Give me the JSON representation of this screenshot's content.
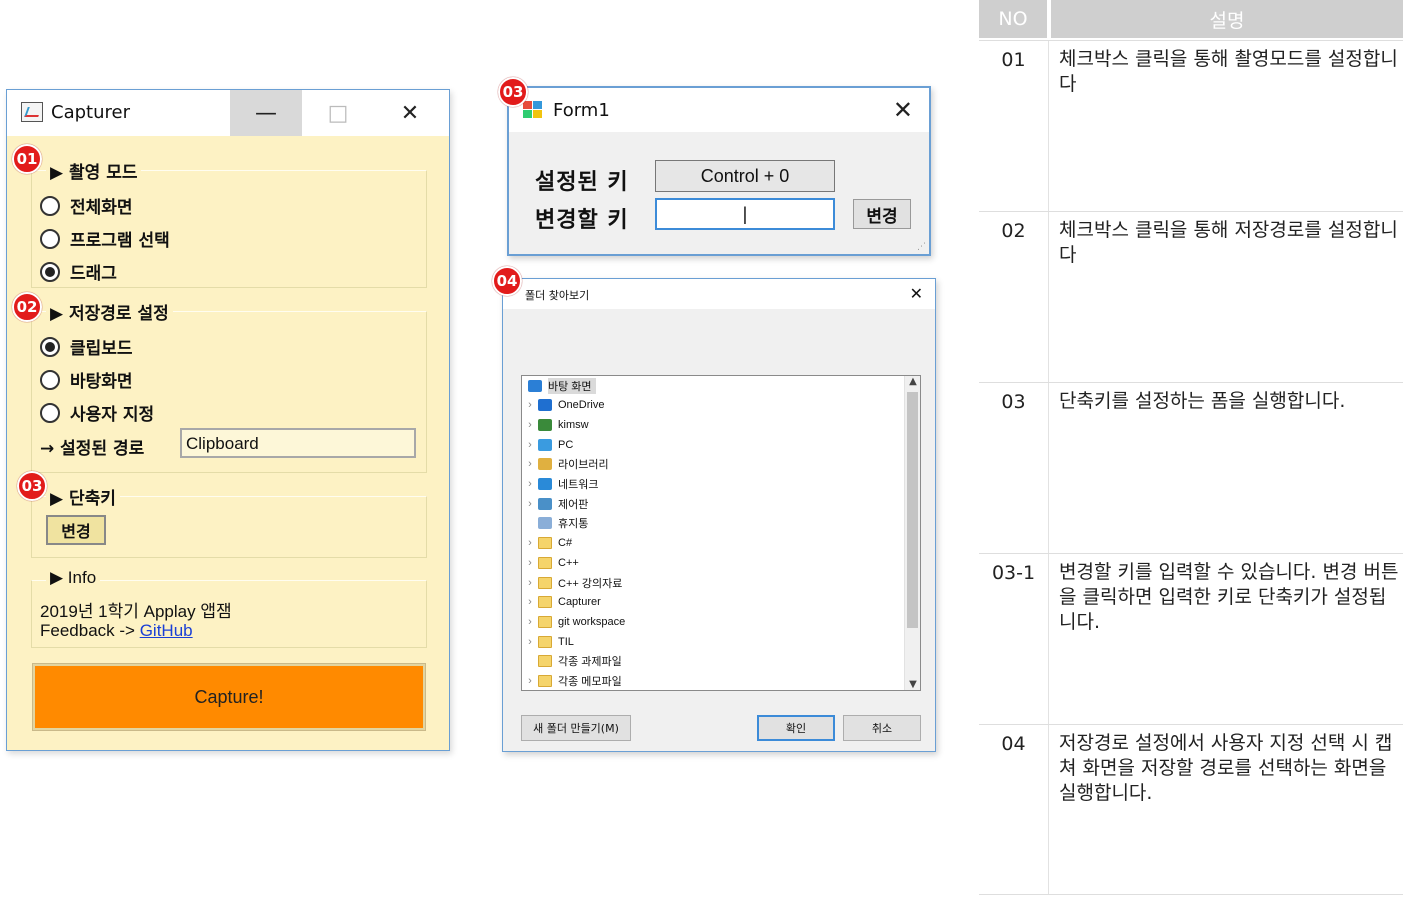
{
  "capturer": {
    "title": "Capturer",
    "minimize": "—",
    "maximize": "□",
    "close": "✕",
    "mode_group": {
      "badge": "01",
      "legend": "▶ 촬영 모드",
      "options": [
        "전체화면",
        "프로그램 선택",
        "드래그"
      ],
      "selected": "드래그"
    },
    "path_group": {
      "badge": "02",
      "legend": "▶ 저장경로 설정",
      "options": [
        "클립보드",
        "바탕화면",
        "사용자 지정"
      ],
      "selected": "클립보드",
      "path_label": "→ 설정된 경로",
      "path_value": "Clipboard"
    },
    "hotkey_group": {
      "badge": "03",
      "legend": "▶ 단축키",
      "change_label": "변경"
    },
    "info_group": {
      "legend": "▶ Info",
      "line1": "2019년 1학기 Applay 앱잼",
      "feedback_prefix": "Feedback -> ",
      "feedback_link": "GitHub"
    },
    "capture_label": "Capture!"
  },
  "form1": {
    "badge": "03",
    "title": "Form1",
    "close": "✕",
    "set_key_label": "설정된 키",
    "set_key_value": "Control + 0",
    "change_key_label": "변경할 키",
    "change_key_value": "|",
    "change_button": "변경"
  },
  "folder_dialog": {
    "badge": "04",
    "title": "폴더 찾아보기",
    "close": "✕",
    "tree": [
      {
        "label": "바탕 화면",
        "icon": "desktop-icon",
        "chev": "",
        "selected": true,
        "indent": 0
      },
      {
        "label": "OneDrive",
        "icon": "cloud-icon",
        "chev": "›",
        "indent": 1
      },
      {
        "label": "kimsw",
        "icon": "user-icon",
        "chev": "›",
        "indent": 1
      },
      {
        "label": "PC",
        "icon": "pc-icon",
        "chev": "›",
        "indent": 1
      },
      {
        "label": "라이브러리",
        "icon": "library-icon",
        "chev": "›",
        "indent": 1
      },
      {
        "label": "네트워크",
        "icon": "network-icon",
        "chev": "›",
        "indent": 1
      },
      {
        "label": "제어판",
        "icon": "control-panel-icon",
        "chev": "›",
        "indent": 1
      },
      {
        "label": "휴지통",
        "icon": "recycle-bin-icon",
        "chev": "",
        "indent": 1
      },
      {
        "label": "C#",
        "icon": "folder-icon",
        "chev": "›",
        "indent": 1
      },
      {
        "label": "C++",
        "icon": "folder-icon",
        "chev": "›",
        "indent": 1
      },
      {
        "label": "C++ 강의자료",
        "icon": "folder-icon",
        "chev": "›",
        "indent": 1
      },
      {
        "label": "Capturer",
        "icon": "folder-icon",
        "chev": "›",
        "indent": 1
      },
      {
        "label": "git workspace",
        "icon": "folder-icon",
        "chev": "›",
        "indent": 1
      },
      {
        "label": "TIL",
        "icon": "folder-icon",
        "chev": "›",
        "indent": 1
      },
      {
        "label": "각종 과제파일",
        "icon": "folder-icon",
        "chev": "",
        "indent": 1
      },
      {
        "label": "각종 메모파일",
        "icon": "folder-icon",
        "chev": "›",
        "indent": 1
      }
    ],
    "new_folder": "새 폴더 만들기(M)",
    "ok": "확인",
    "cancel": "취소"
  },
  "description_table": {
    "headers": [
      "NO",
      "설명"
    ],
    "rows": [
      {
        "no": "01",
        "text": "체크박스 클릭을 통해 촬영모드를 설정합니다"
      },
      {
        "no": "02",
        "text": "체크박스 클릭을 통해 저장경로를 설정합니다"
      },
      {
        "no": "03",
        "text": "단축키를 설정하는 폼을 실행합니다."
      },
      {
        "no": "03-1",
        "text": "변경할 키를 입력할 수 있습니다. 변경 버튼을 클릭하면 입력한 키로 단축키가 설정됩니다."
      },
      {
        "no": "04",
        "text": "저장경로 설정에서 사용자 지정 선택 시 캡쳐 화면을 저장할 경로를 선택하는 화면을 실행합니다."
      }
    ]
  },
  "colors": {
    "badge": "#e21b1b",
    "capture_button": "#ff8a00",
    "window_bg": "#fdf2c4",
    "header_bg": "#cfcfcf"
  }
}
